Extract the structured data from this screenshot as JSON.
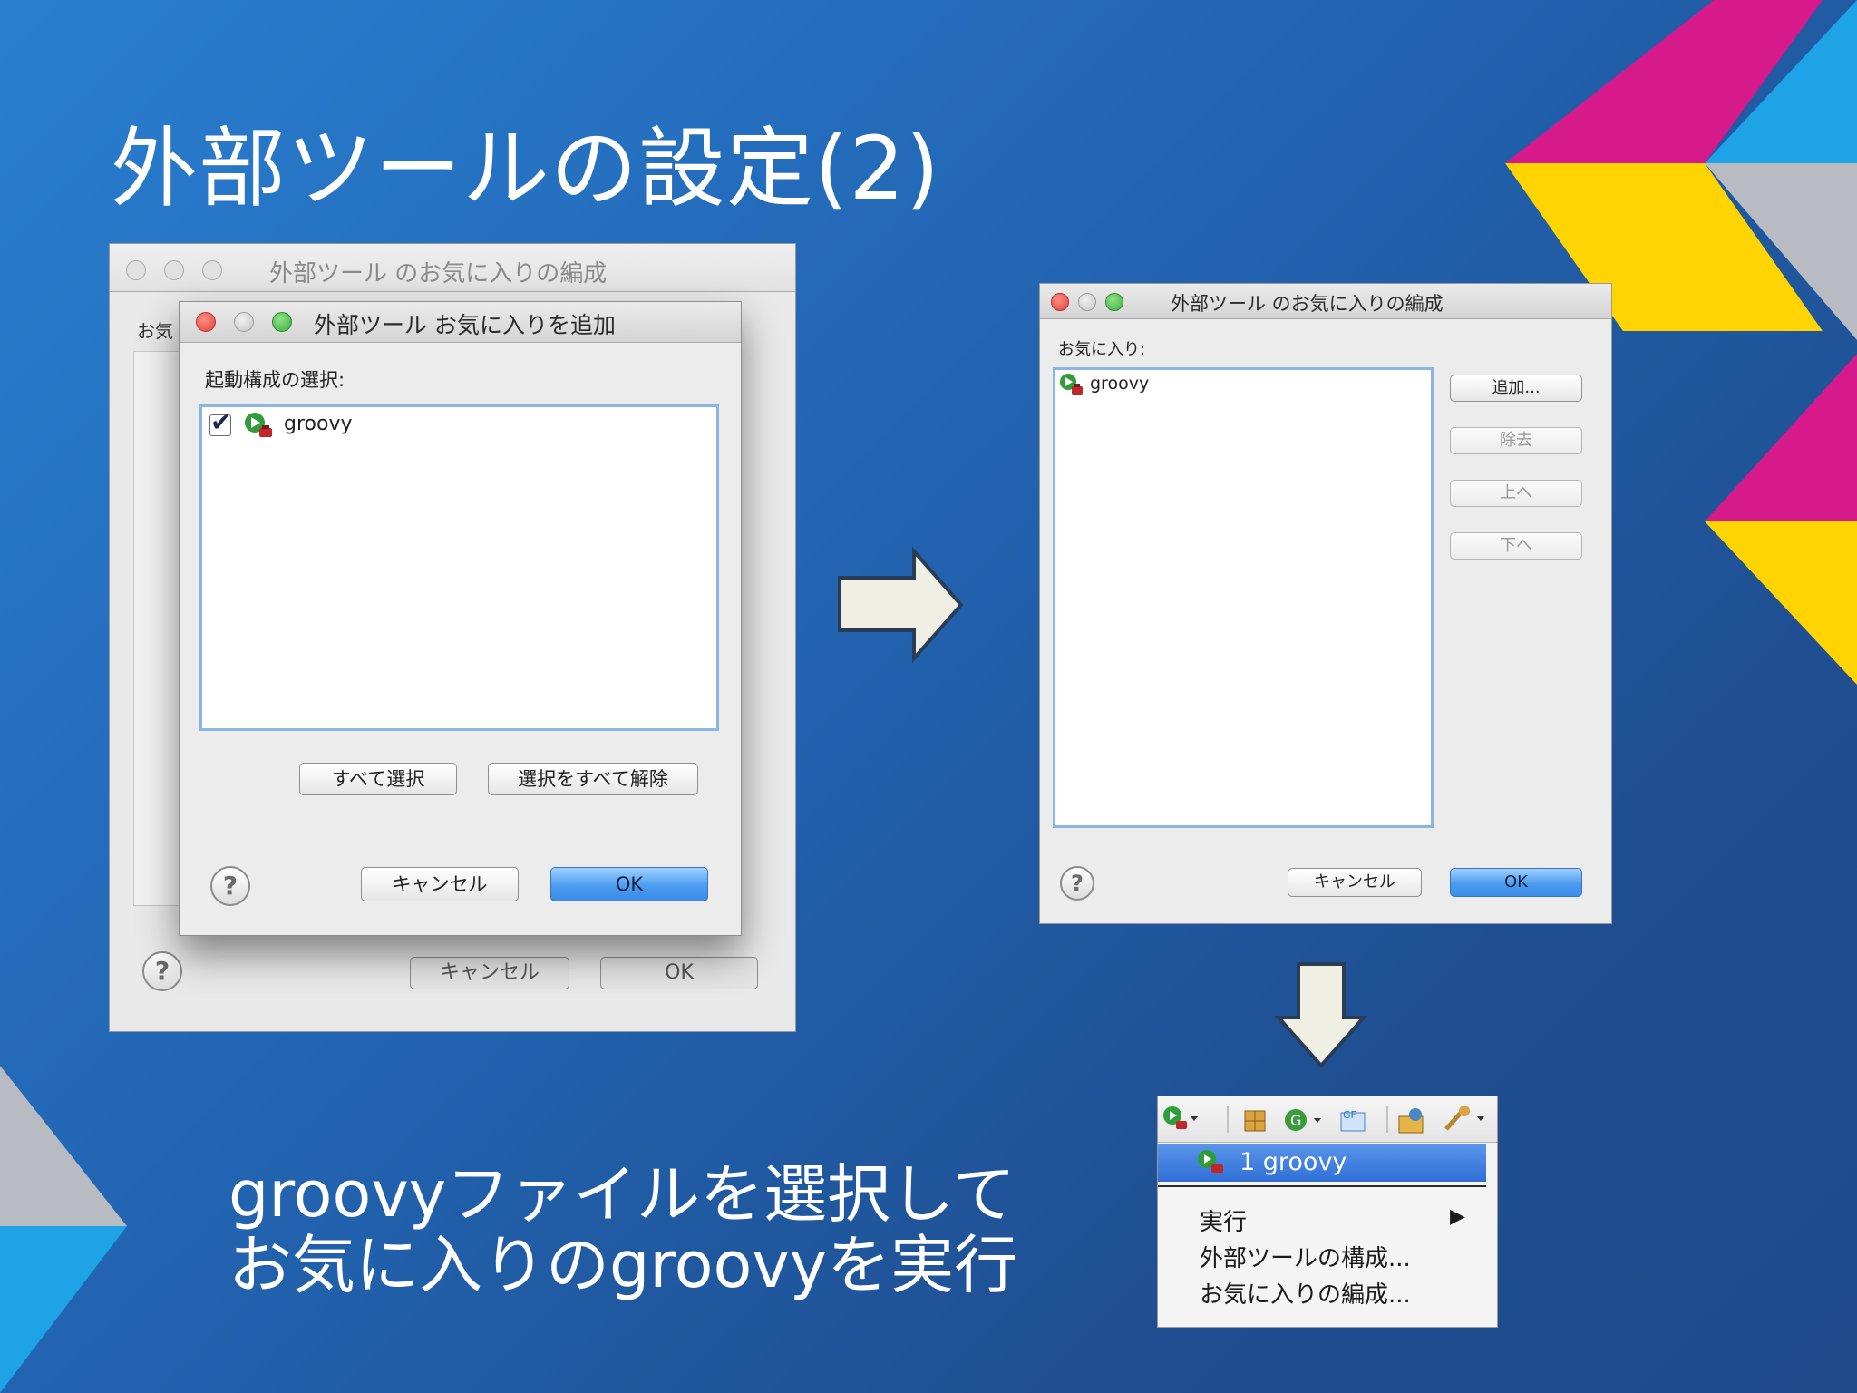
{
  "slide": {
    "title": "外部ツールの設定(2)",
    "caption_line1": "groovyファイルを選択して",
    "caption_line2": "お気に入りのgroovyを実行"
  },
  "back_dialog": {
    "title": "外部ツール のお気に入りの編成",
    "partial_label": "お気",
    "cancel": "キャンセル",
    "ok": "OK"
  },
  "add_dialog": {
    "title": "外部ツール お気に入りを追加",
    "section_label": "起動構成の選択:",
    "items": [
      {
        "label": "groovy",
        "checked": true
      }
    ],
    "select_all": "すべて選択",
    "deselect_all": "選択をすべて解除",
    "cancel": "キャンセル",
    "ok": "OK"
  },
  "organize_dialog": {
    "title": "外部ツール のお気に入りの編成",
    "favorites_label": "お気に入り:",
    "items": [
      {
        "label": "groovy"
      }
    ],
    "add": "追加...",
    "remove": "除去",
    "up": "上へ",
    "down": "下へ",
    "cancel": "キャンセル",
    "ok": "OK"
  },
  "menu": {
    "highlighted": "1 groovy",
    "run": "実行",
    "configure": "外部ツールの構成...",
    "organize": "お気に入りの編成...",
    "toolbar_icons": [
      "external-tools-run-icon",
      "new-package-icon",
      "new-class-icon",
      "new-groovy-icon",
      "open-type-icon",
      "search-icon"
    ]
  },
  "colors": {
    "background": "#2266b4",
    "accent_magenta": "#d6198b",
    "accent_yellow": "#ffd400",
    "accent_cyan": "#1ea3e6",
    "accent_gray": "#b8bcc2",
    "selection_blue": "#3b7de0"
  }
}
